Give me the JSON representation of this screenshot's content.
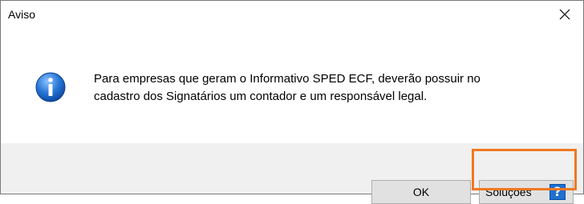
{
  "window": {
    "title": "Aviso",
    "close_glyph": "✕"
  },
  "message": {
    "icon": "info-icon",
    "line1": "Para empresas que geram o Informativo SPED ECF, deverão possuir no",
    "line2": "cadastro dos Signatários um contador e um responsável legal."
  },
  "buttons": {
    "ok_label": "OK",
    "solucoes_label": "Soluções",
    "solucoes_icon": "help-icon",
    "solucoes_icon_glyph": "?"
  },
  "colors": {
    "highlight": "#f07820",
    "help_icon_bg": "#1f6fd0",
    "footer_bg": "#f0f0f0"
  }
}
